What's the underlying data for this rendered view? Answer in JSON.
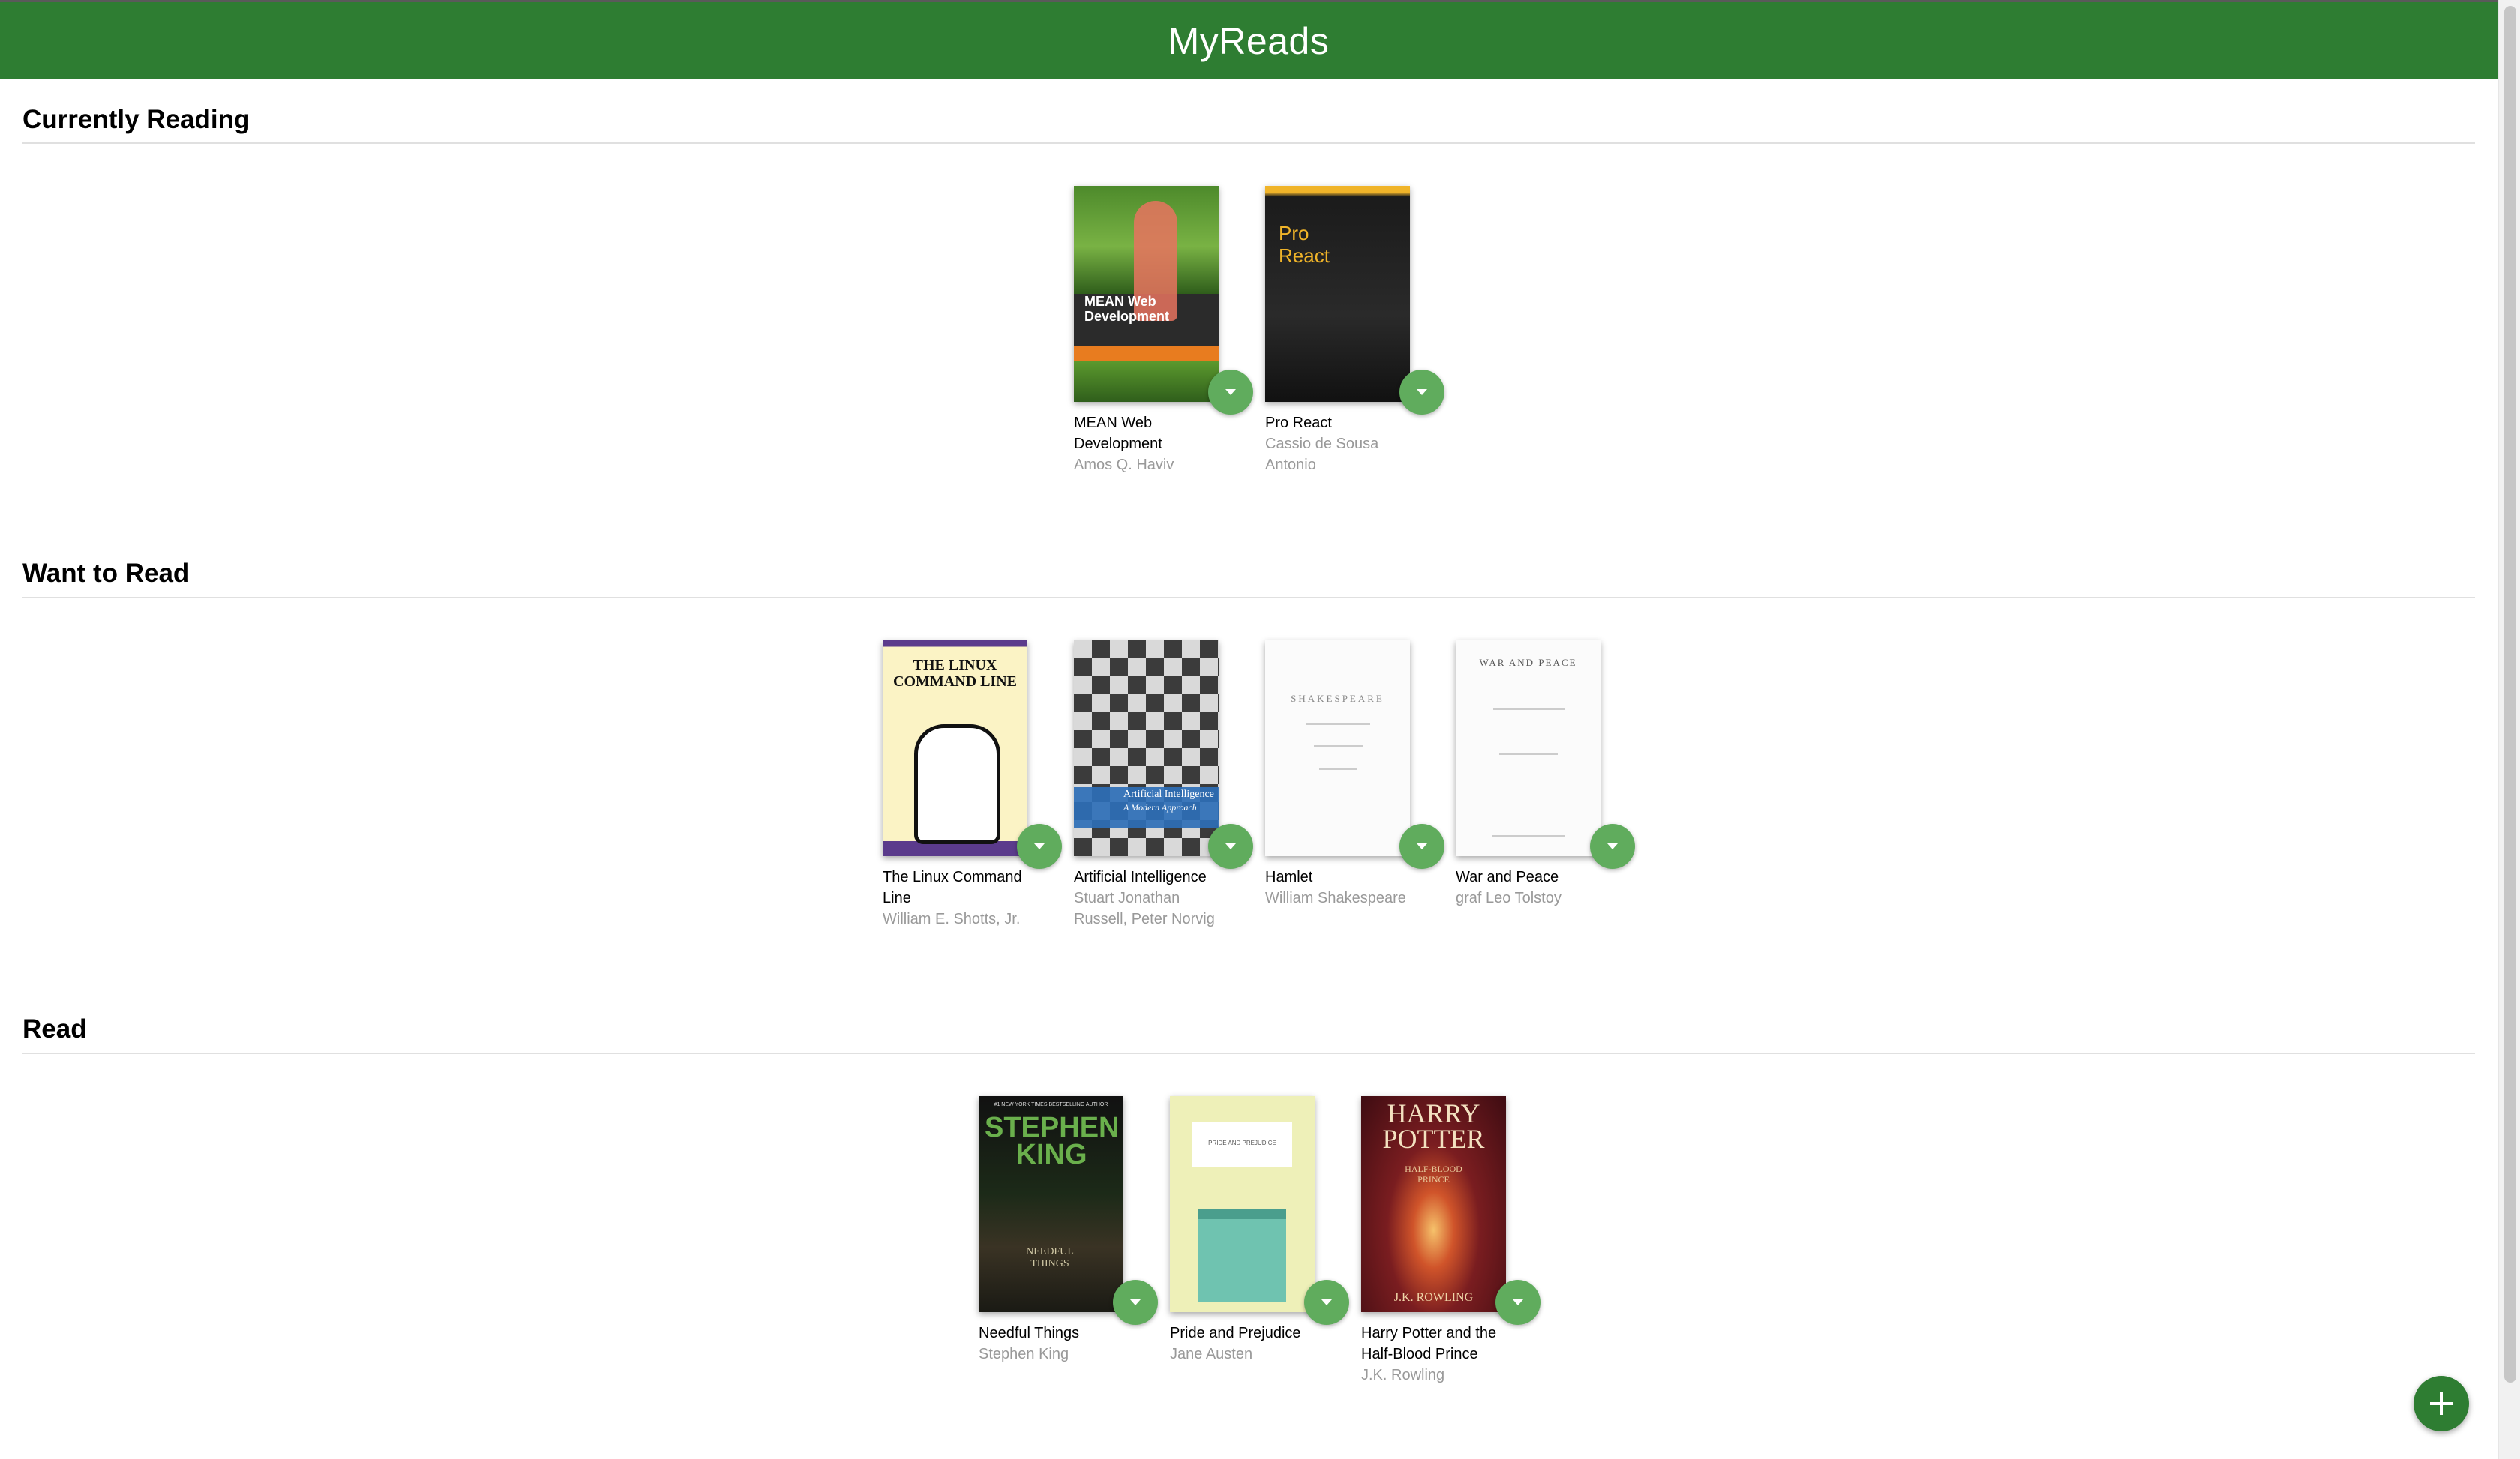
{
  "app": {
    "title": "MyReads"
  },
  "colors": {
    "header": "#2e7d32",
    "shelf_changer": "#60ac5d",
    "add_button": "#2e7d32",
    "author_text": "#999999"
  },
  "shelves": [
    {
      "title": "Currently Reading",
      "books": [
        {
          "title": "MEAN Web Development",
          "authors": "Amos Q. Haviv",
          "cover": "green flamingo cover"
        },
        {
          "title": "Pro React",
          "authors": "Cassio de Sousa Antonio",
          "cover": "black and yellow cover"
        }
      ]
    },
    {
      "title": "Want to Read",
      "books": [
        {
          "title": "The Linux Command Line",
          "authors": "William E. Shotts, Jr.",
          "cover": "yellow cartoon cover"
        },
        {
          "title": "Artificial Intelligence",
          "authors": "Stuart Jonathan Russell, Peter Norvig",
          "cover": "chessboard cover"
        },
        {
          "title": "Hamlet",
          "authors": "William Shakespeare",
          "cover": "white title page"
        },
        {
          "title": "War and Peace",
          "authors": "graf Leo Tolstoy",
          "cover": "white title page"
        }
      ]
    },
    {
      "title": "Read",
      "books": [
        {
          "title": "Needful Things",
          "authors": "Stephen King",
          "cover": "dark green cover"
        },
        {
          "title": "Pride and Prejudice",
          "authors": "Jane Austen",
          "cover": "pale yellow house cover"
        },
        {
          "title": "Harry Potter and the Half-Blood Prince",
          "authors": "J.K. Rowling",
          "cover": "red book cover"
        }
      ]
    }
  ],
  "cover_text": {
    "mean": "MEAN Web Development",
    "pro_react": "Pro React",
    "linux": "THE LINUX COMMAND LINE",
    "ai": "Artificial Intelligence",
    "ai_sub": "A Modern Approach",
    "hamlet": "SHAKESPEARE",
    "war": "WAR AND PEACE",
    "king_top": "#1 NEW YORK TIMES BESTSELLING AUTHOR",
    "king_name": "STEPHEN KING",
    "needful": "NEEDFUL THINGS",
    "pride": "PRIDE AND PREJUDICE",
    "hp_title": "HARRY POTTER",
    "hp_sub": "HALF-BLOOD PRINCE",
    "hp_author": "J.K. ROWLING"
  },
  "icons": {
    "shelf_changer": "arrow-drop-down-icon",
    "add": "plus-icon"
  }
}
